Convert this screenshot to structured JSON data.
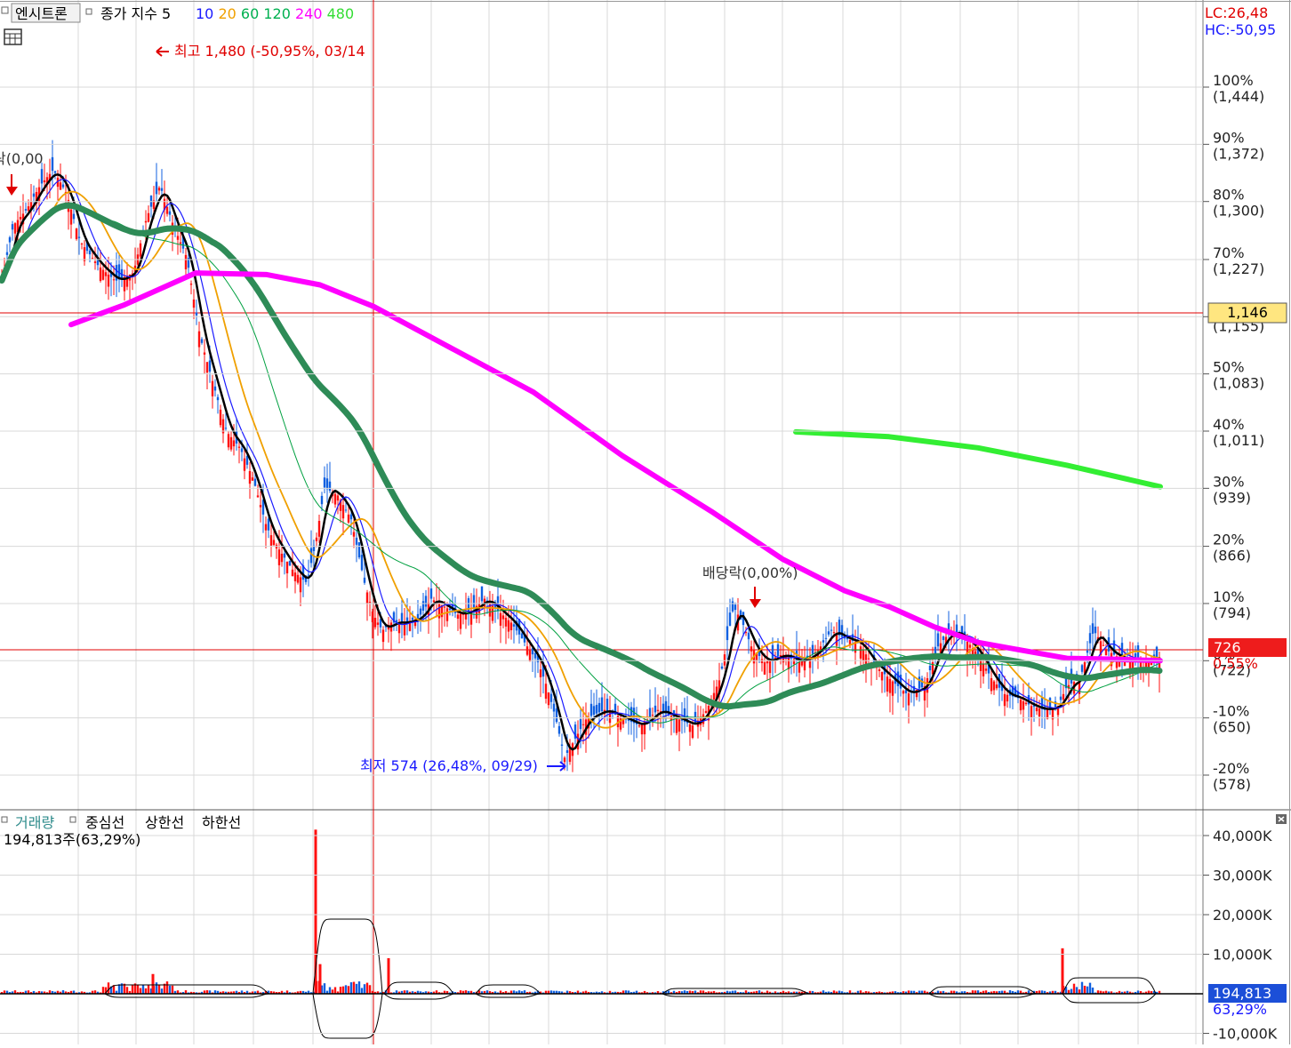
{
  "stock_name": "엔시트론",
  "price_legend": {
    "label": "종가 지수 5",
    "ma_periods": [
      {
        "label": "10",
        "color": "#1a1aff"
      },
      {
        "label": "20",
        "color": "#f0a000"
      },
      {
        "label": "60",
        "color": "#00b050"
      },
      {
        "label": "120",
        "color": "#00b050"
      },
      {
        "label": "240",
        "color": "#ff00ff"
      },
      {
        "label": "480",
        "color": "#33dd33"
      }
    ]
  },
  "top_right": {
    "lc": "LC:26,48",
    "hc": "HC:-50,95"
  },
  "annotations": {
    "high": "최고 1,480 (-50,95%, 03/14",
    "low": "최저 574 (26,48%, 09/29)",
    "dividend": "배당락(0,00%)",
    "dividend_left": "락(0,00"
  },
  "current_price": {
    "value": "726",
    "change": "0,55%"
  },
  "crosshair_price": "1,146",
  "volume_legend": {
    "title": "거래량",
    "items": [
      "중심선",
      "상한선",
      "하한선"
    ],
    "value": "194,813주(63,29%)"
  },
  "volume_current": {
    "value": "194,813",
    "change": "63,29%"
  },
  "colors": {
    "up": "#ff1010",
    "down": "#1060e0",
    "ma5": "#000000",
    "ma10": "#1a1aff",
    "ma20": "#f0a000",
    "ma60": "#00a040",
    "ma120": "#2e8b57",
    "ma240": "#ff00ff",
    "ma480": "#33ee33",
    "grid": "#d8d8d8",
    "crosshair": "#e00000"
  },
  "chart_data": {
    "type": "line",
    "price_axis": {
      "ticks": [
        {
          "pct": "100%",
          "price": "(1,444)",
          "value": 1444
        },
        {
          "pct": "90%",
          "price": "(1,372)",
          "value": 1372
        },
        {
          "pct": "80%",
          "price": "(1,300)",
          "value": 1300
        },
        {
          "pct": "70%",
          "price": "(1,227)",
          "value": 1227
        },
        {
          "pct": "60%",
          "price": "(1,155)",
          "value": 1155
        },
        {
          "pct": "50%",
          "price": "(1,083)",
          "value": 1083
        },
        {
          "pct": "40%",
          "price": "(1,011)",
          "value": 1011
        },
        {
          "pct": "30%",
          "price": "(939)",
          "value": 939
        },
        {
          "pct": "20%",
          "price": "(866)",
          "value": 866
        },
        {
          "pct": "10%",
          "price": "(794)",
          "value": 794
        },
        {
          "pct": "0%",
          "price": "(722)",
          "value": 722
        },
        {
          "pct": "-10%",
          "price": "(650)",
          "value": 650
        },
        {
          "pct": "-20%",
          "price": "(578)",
          "value": 578
        }
      ]
    },
    "volume_axis": {
      "ticks": [
        {
          "label": "40,000K",
          "value": 40000
        },
        {
          "label": "30,000K",
          "value": 30000
        },
        {
          "label": "20,000K",
          "value": 20000
        },
        {
          "label": "10,000K",
          "value": 10000
        },
        {
          "label": "-10,000K",
          "value": -10000
        }
      ]
    },
    "close_path": [
      [
        0,
        1190
      ],
      [
        15,
        1270
      ],
      [
        30,
        1290
      ],
      [
        45,
        1320
      ],
      [
        60,
        1340
      ],
      [
        75,
        1310
      ],
      [
        90,
        1250
      ],
      [
        110,
        1220
      ],
      [
        130,
        1200
      ],
      [
        150,
        1210
      ],
      [
        165,
        1280
      ],
      [
        180,
        1320
      ],
      [
        195,
        1270
      ],
      [
        210,
        1230
      ],
      [
        225,
        1130
      ],
      [
        240,
        1070
      ],
      [
        255,
        1010
      ],
      [
        270,
        990
      ],
      [
        285,
        950
      ],
      [
        300,
        890
      ],
      [
        315,
        860
      ],
      [
        330,
        835
      ],
      [
        345,
        820
      ],
      [
        355,
        870
      ],
      [
        365,
        940
      ],
      [
        380,
        930
      ],
      [
        395,
        900
      ],
      [
        410,
        820
      ],
      [
        420,
        780
      ],
      [
        430,
        760
      ],
      [
        440,
        770
      ],
      [
        455,
        770
      ],
      [
        470,
        775
      ],
      [
        485,
        800
      ],
      [
        500,
        790
      ],
      [
        515,
        780
      ],
      [
        530,
        785
      ],
      [
        545,
        800
      ],
      [
        560,
        785
      ],
      [
        575,
        770
      ],
      [
        590,
        745
      ],
      [
        605,
        720
      ],
      [
        615,
        690
      ],
      [
        625,
        650
      ],
      [
        635,
        600
      ],
      [
        645,
        620
      ],
      [
        660,
        650
      ],
      [
        680,
        660
      ],
      [
        700,
        650
      ],
      [
        720,
        640
      ],
      [
        740,
        660
      ],
      [
        760,
        650
      ],
      [
        780,
        640
      ],
      [
        795,
        660
      ],
      [
        810,
        700
      ],
      [
        825,
        790
      ],
      [
        835,
        770
      ],
      [
        845,
        740
      ],
      [
        860,
        720
      ],
      [
        880,
        730
      ],
      [
        900,
        720
      ],
      [
        920,
        735
      ],
      [
        935,
        760
      ],
      [
        950,
        750
      ],
      [
        965,
        745
      ],
      [
        980,
        720
      ],
      [
        1000,
        700
      ],
      [
        1020,
        680
      ],
      [
        1040,
        690
      ],
      [
        1055,
        740
      ],
      [
        1070,
        760
      ],
      [
        1085,
        750
      ],
      [
        1100,
        730
      ],
      [
        1115,
        700
      ],
      [
        1130,
        680
      ],
      [
        1145,
        675
      ],
      [
        1160,
        665
      ],
      [
        1175,
        660
      ],
      [
        1190,
        665
      ],
      [
        1200,
        690
      ],
      [
        1215,
        700
      ],
      [
        1230,
        760
      ],
      [
        1245,
        735
      ],
      [
        1260,
        725
      ],
      [
        1280,
        722
      ],
      [
        1300,
        726
      ]
    ],
    "ma240_path": [
      [
        80,
        1145
      ],
      [
        140,
        1170
      ],
      [
        220,
        1210
      ],
      [
        300,
        1208
      ],
      [
        360,
        1195
      ],
      [
        420,
        1168
      ],
      [
        500,
        1120
      ],
      [
        600,
        1060
      ],
      [
        700,
        980
      ],
      [
        800,
        910
      ],
      [
        880,
        850
      ],
      [
        950,
        810
      ],
      [
        1000,
        790
      ],
      [
        1050,
        765
      ],
      [
        1100,
        745
      ],
      [
        1150,
        735
      ],
      [
        1200,
        725
      ],
      [
        1250,
        724
      ],
      [
        1305,
        722
      ]
    ],
    "ma480_path": [
      [
        895,
        1010
      ],
      [
        1000,
        1004
      ],
      [
        1100,
        990
      ],
      [
        1200,
        968
      ],
      [
        1305,
        941
      ]
    ]
  }
}
